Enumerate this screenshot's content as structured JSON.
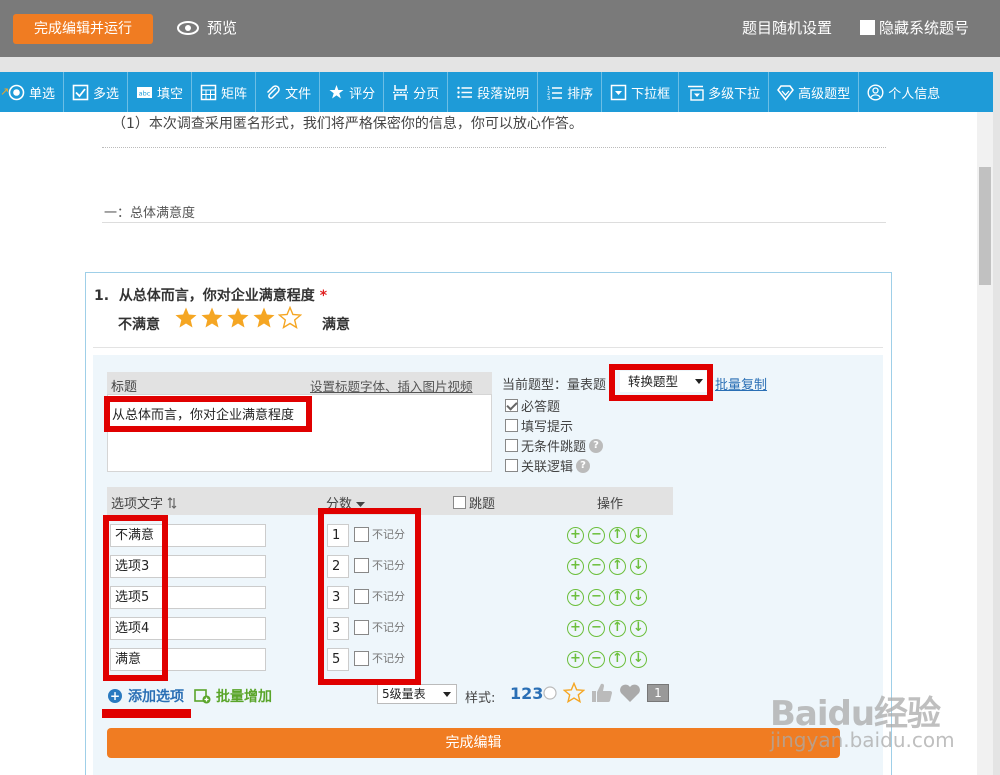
{
  "topbar": {
    "finish_run": "完成编辑并运行",
    "preview": "预览",
    "random_setting": "题目随机设置",
    "hide_system_id": "隐藏系统题号"
  },
  "toolbar": {
    "items": [
      {
        "label": "单选",
        "icon": "radio-icon"
      },
      {
        "label": "多选",
        "icon": "checkbox-icon"
      },
      {
        "label": "填空",
        "icon": "text-field-icon"
      },
      {
        "label": "矩阵",
        "icon": "matrix-icon"
      },
      {
        "label": "文件",
        "icon": "paperclip-icon"
      },
      {
        "label": "评分",
        "icon": "rating-icon"
      },
      {
        "label": "分页",
        "icon": "page-break-icon"
      },
      {
        "label": "段落说明",
        "icon": "paragraph-icon"
      },
      {
        "label": "排序",
        "icon": "sort-icon"
      },
      {
        "label": "下拉框",
        "icon": "dropdown-icon"
      },
      {
        "label": "多级下拉",
        "icon": "multi-dropdown-icon"
      },
      {
        "label": "高级题型",
        "icon": "diamond-icon"
      },
      {
        "label": "个人信息",
        "icon": "user-icon"
      }
    ]
  },
  "content": {
    "privacy_note": "（1）本次调查采用匿名形式，我们将严格保密你的信息，你可以放心作答。",
    "section_title": "一：总体满意度"
  },
  "question": {
    "number": "1.",
    "title": "从总体而言，你对企业满意程度",
    "required_mark": "*",
    "scale_low": "不满意",
    "scale_high": "满意",
    "rating_filled": 4,
    "rating_total": 5
  },
  "editor": {
    "title_label": "标题",
    "set_font_link": "设置标题字体、插入图片视频",
    "title_value": "从总体而言，你对企业满意程度",
    "current_type_label": "当前题型：量表题",
    "convert_type": "转换题型",
    "batch_copy": "批量复制",
    "checks": [
      {
        "label": "必答题",
        "checked": true,
        "help": false
      },
      {
        "label": "填写提示",
        "checked": false,
        "help": false
      },
      {
        "label": "无条件跳题",
        "checked": false,
        "help": true
      },
      {
        "label": "关联逻辑",
        "checked": false,
        "help": true
      }
    ],
    "headers": {
      "option_text": "选项文字",
      "score": "分数",
      "jump": "跳题",
      "ops": "操作"
    },
    "no_score_label": "不记分",
    "options": [
      {
        "text": "不满意",
        "score": "1"
      },
      {
        "text": "选项3",
        "score": "2"
      },
      {
        "text": "选项5",
        "score": "3"
      },
      {
        "text": "选项4",
        "score": "3"
      },
      {
        "text": "满意",
        "score": "5"
      }
    ],
    "add_option": "添加选项",
    "batch_add": "批量增加",
    "scale_select": "5级量表",
    "style_label": "样式:",
    "style_num": "123",
    "style_one": "1",
    "done": "完成编辑"
  },
  "watermark": {
    "logo": "Baidu经验",
    "url": "jingyan.baidu.com"
  },
  "colors": {
    "accent_orange": "#f07c22",
    "toolbar_blue": "#1e9bd8",
    "highlight_red": "#e00000",
    "star_gold": "#f5a623",
    "op_green": "#6cbf3c",
    "link_blue": "#2a6fb5"
  }
}
